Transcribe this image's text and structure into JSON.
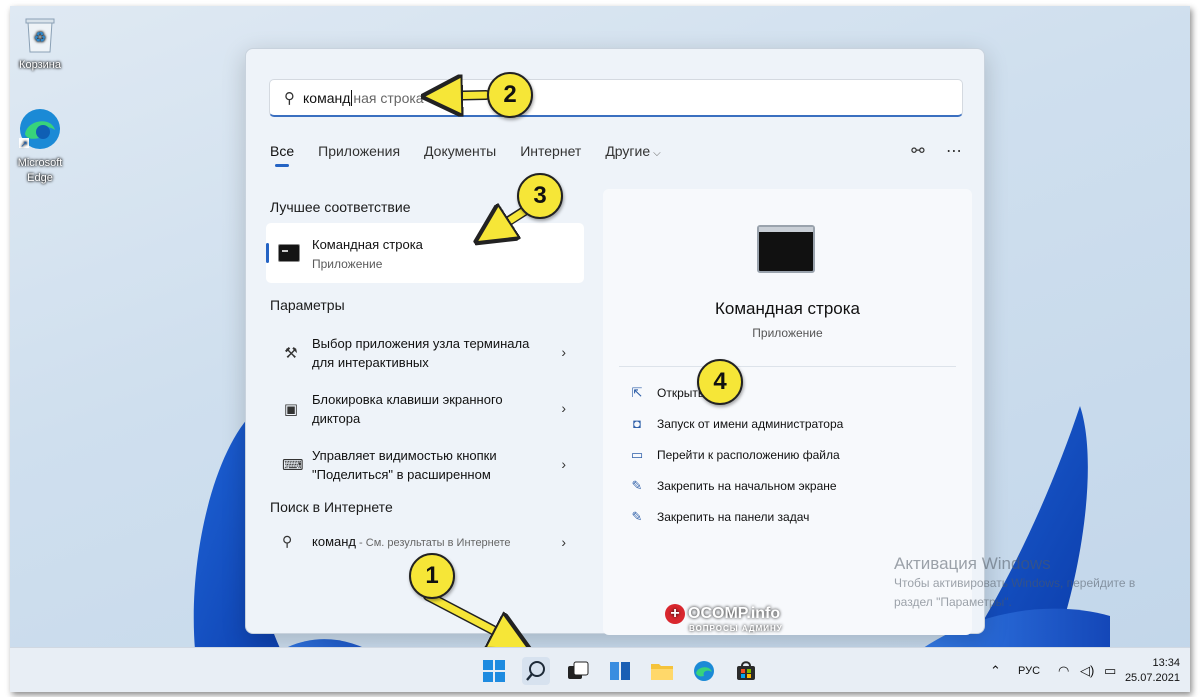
{
  "desktop": {
    "icons": [
      {
        "label": "Корзина",
        "icon": "recycle-bin-icon"
      },
      {
        "label": "Microsoft Edge",
        "icon": "edge-icon"
      }
    ]
  },
  "search": {
    "typed": "команд",
    "suggestion": "ная строка"
  },
  "tabs": [
    {
      "label": "Все"
    },
    {
      "label": "Приложения"
    },
    {
      "label": "Документы"
    },
    {
      "label": "Интернет"
    },
    {
      "label": "Другие"
    }
  ],
  "best_match": {
    "section": "Лучшее соответствие",
    "title": "Командная строка",
    "subtitle": "Приложение"
  },
  "settings": {
    "section": "Параметры",
    "items": [
      {
        "text": "Выбор приложения узла терминала для интерактивных",
        "icon": "settings-tools-icon"
      },
      {
        "text": "Блокировка клавиши экранного диктора",
        "icon": "narrator-lock-icon"
      },
      {
        "text": "Управляет видимостью кнопки \"Поделиться\" в расширенном",
        "icon": "keyboard-icon"
      }
    ]
  },
  "web": {
    "section": "Поиск в Интернете",
    "query": "команд",
    "hint": " - См. результаты в Интернете"
  },
  "detail": {
    "title": "Командная строка",
    "subtitle": "Приложение",
    "actions": [
      {
        "label": "Открыть",
        "icon": "open-external-icon"
      },
      {
        "label": "Запуск от имени администратора",
        "icon": "admin-shield-icon"
      },
      {
        "label": "Перейти к расположению файла",
        "icon": "folder-icon"
      },
      {
        "label": "Закрепить на начальном экране",
        "icon": "pin-icon"
      },
      {
        "label": "Закрепить на панели задач",
        "icon": "pin-icon"
      }
    ]
  },
  "badges": [
    "1",
    "2",
    "3",
    "4"
  ],
  "activation": {
    "title": "Активация Windows",
    "line1": "Чтобы активировать Windows, перейдите в",
    "line2": "раздел \"Параметры\"."
  },
  "watermark": {
    "brand": "OCOMP.info",
    "tagline": "ВОПРОСЫ АДМИНУ"
  },
  "taskbar": {
    "language": "РУС",
    "time": "13:34",
    "date": "25.07.2021"
  },
  "colors": {
    "accent": "#2463c4",
    "badge": "#f6e637",
    "arrow": "#f6e637"
  }
}
